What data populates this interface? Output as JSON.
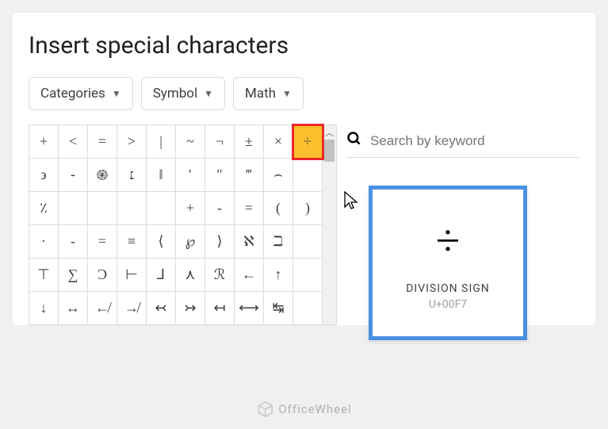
{
  "title": "Insert special characters",
  "dropdowns": {
    "categories": "Categories",
    "symbol": "Symbol",
    "math": "Math"
  },
  "search": {
    "placeholder": "Search by keyword"
  },
  "tooltip": {
    "glyph": "÷",
    "name": "DIVISION SIGN",
    "code": "U+00F7"
  },
  "rows": [
    [
      "+",
      "<",
      "=",
      ">",
      "|",
      "~",
      "¬",
      "±",
      "×",
      "÷"
    ],
    [
      "϶",
      "֊",
      "֍",
      "׆",
      "‖",
      "′",
      "″",
      "‴",
      "⌢",
      ""
    ],
    [
      "٪",
      "",
      "",
      "",
      "",
      "+",
      "-",
      "=",
      "(",
      ")"
    ],
    [
      "·",
      "-",
      "=",
      "≡",
      "⟨",
      "℘",
      "⟩",
      "ℵ",
      "ℶ",
      ""
    ],
    [
      "⊤",
      "∑",
      "Ɔ",
      "⊢",
      "⅃",
      "⋏",
      "ℛ",
      "←",
      "↑",
      ""
    ],
    [
      "↓",
      "↔",
      "↚",
      "↛",
      "↢",
      "↣",
      "↤",
      "⟷",
      "↹",
      ""
    ]
  ],
  "selected": {
    "row": 0,
    "col": 9
  },
  "watermark": "OfficeWheel"
}
